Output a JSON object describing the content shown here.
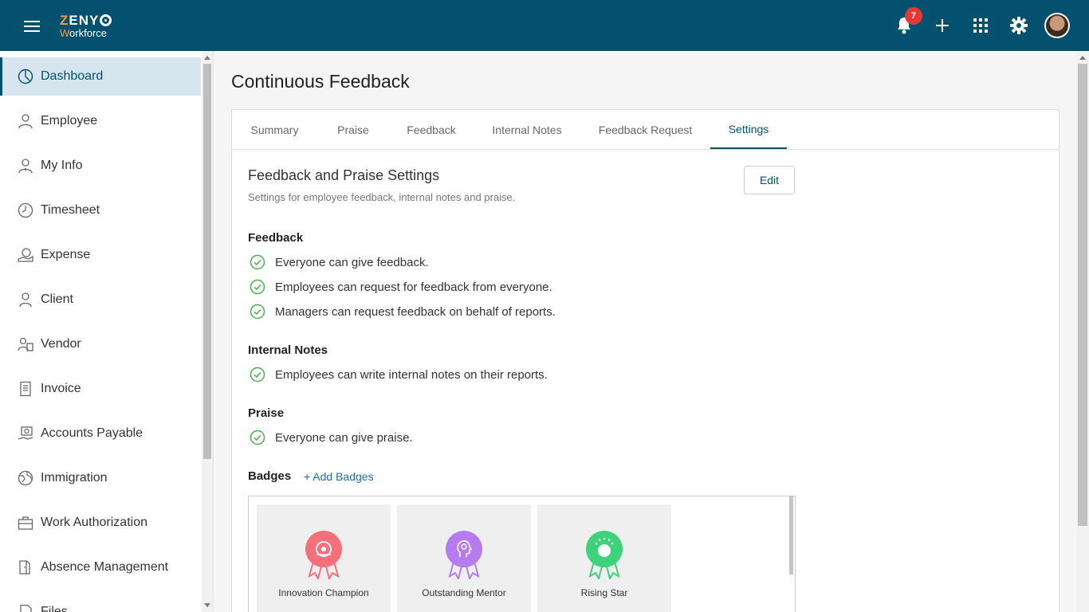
{
  "header": {
    "logo_top_z": "Z",
    "logo_top_rest": "ENY",
    "logo_bottom_w": "W",
    "logo_bottom_rest": "orkforce",
    "notification_count": "7",
    "accent_color": "#03506f"
  },
  "sidebar": {
    "items": [
      {
        "label": "Dashboard",
        "icon": "pie-chart-icon"
      },
      {
        "label": "Employee",
        "icon": "employee-icon"
      },
      {
        "label": "My Info",
        "icon": "my-info-icon"
      },
      {
        "label": "Timesheet",
        "icon": "clock-icon"
      },
      {
        "label": "Expense",
        "icon": "expense-icon"
      },
      {
        "label": "Client",
        "icon": "person-icon"
      },
      {
        "label": "Vendor",
        "icon": "vendor-icon"
      },
      {
        "label": "Invoice",
        "icon": "invoice-icon"
      },
      {
        "label": "Accounts Payable",
        "icon": "payable-icon"
      },
      {
        "label": "Immigration",
        "icon": "globe-icon"
      },
      {
        "label": "Work Authorization",
        "icon": "briefcase-icon"
      },
      {
        "label": "Absence Management",
        "icon": "exit-door-icon"
      },
      {
        "label": "Files",
        "icon": "file-icon"
      }
    ]
  },
  "main": {
    "page_title": "Continuous Feedback",
    "tabs": [
      {
        "label": "Summary"
      },
      {
        "label": "Praise"
      },
      {
        "label": "Feedback"
      },
      {
        "label": "Internal Notes"
      },
      {
        "label": "Feedback Request"
      },
      {
        "label": "Settings"
      }
    ],
    "active_tab": "Settings",
    "section_title": "Feedback and Praise Settings",
    "section_subtitle": "Settings for employee feedback, internal notes and praise.",
    "edit_label": "Edit",
    "feedback": {
      "title": "Feedback",
      "items": [
        "Everyone can give feedback.",
        "Employees can request for feedback from everyone.",
        "Managers can request feedback on behalf of reports."
      ]
    },
    "internal_notes": {
      "title": "Internal Notes",
      "items": [
        "Employees can write internal notes on their reports."
      ]
    },
    "praise": {
      "title": "Praise",
      "items": [
        "Everyone can give praise."
      ]
    },
    "badges": {
      "title": "Badges",
      "add_label": "+ Add Badges",
      "items": [
        {
          "name": "Innovation Champion",
          "color": "#f4707a",
          "icon": "innovation-badge-icon"
        },
        {
          "name": "Outstanding Mentor",
          "color": "#b57bef",
          "icon": "mentor-badge-icon"
        },
        {
          "name": "Rising Star",
          "color": "#3ed27a",
          "icon": "rising-star-badge-icon"
        }
      ]
    },
    "check_color": "#4caf50"
  }
}
